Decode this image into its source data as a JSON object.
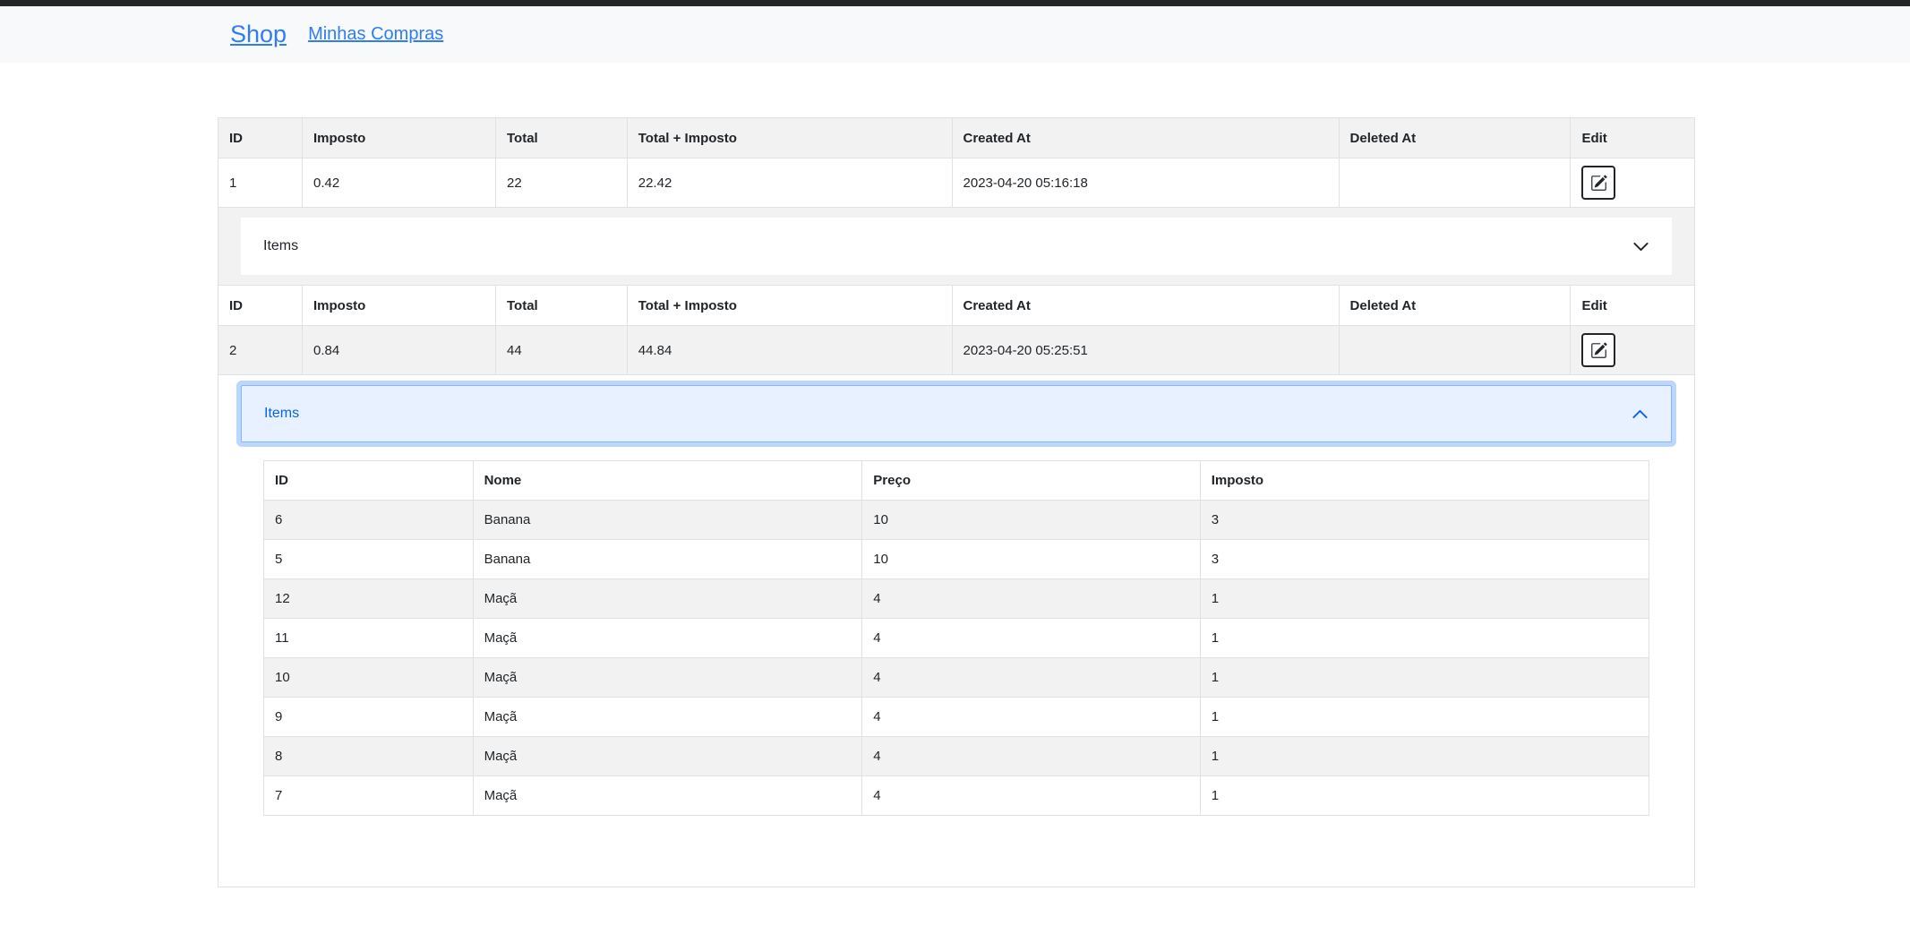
{
  "nav": {
    "brand": "Shop",
    "links": [
      {
        "label": "Minhas Compras"
      }
    ]
  },
  "colors": {
    "link_blue": "#2f7df6",
    "accordion_active_bg": "#e7f1ff",
    "accordion_active_text": "#0c63e4",
    "accordion_focus_ring": "rgba(13,110,253,.28)",
    "stripe_bg": "#f2f2f2",
    "table_border": "#dee2e6",
    "text": "#212529",
    "navbar_bg": "#f8f9fa",
    "top_strip": "#262626"
  },
  "icons": {
    "edit": "pencil-square",
    "collapsed": "chevron-down",
    "expanded": "chevron-up"
  },
  "purchases_table": {
    "headers": [
      "ID",
      "Imposto",
      "Total",
      "Total + Imposto",
      "Created At",
      "Deleted At",
      "Edit"
    ],
    "accordion_label": "Items",
    "rows": [
      {
        "id": "1",
        "imposto": "0.42",
        "total": "22",
        "total_imposto": "22.42",
        "created_at": "2023-04-20 05:16:18",
        "deleted_at": "",
        "accordion_state": "collapsed"
      },
      {
        "id": "2",
        "imposto": "0.84",
        "total": "44",
        "total_imposto": "44.84",
        "created_at": "2023-04-20 05:25:51",
        "deleted_at": "",
        "accordion_state": "expanded"
      }
    ]
  },
  "items_table": {
    "headers": [
      "ID",
      "Nome",
      "Preço",
      "Imposto"
    ],
    "rows": [
      [
        "6",
        "Banana",
        "10",
        "3"
      ],
      [
        "5",
        "Banana",
        "10",
        "3"
      ],
      [
        "12",
        "Maçã",
        "4",
        "1"
      ],
      [
        "11",
        "Maçã",
        "4",
        "1"
      ],
      [
        "10",
        "Maçã",
        "4",
        "1"
      ],
      [
        "9",
        "Maçã",
        "4",
        "1"
      ],
      [
        "8",
        "Maçã",
        "4",
        "1"
      ],
      [
        "7",
        "Maçã",
        "4",
        "1"
      ]
    ]
  }
}
